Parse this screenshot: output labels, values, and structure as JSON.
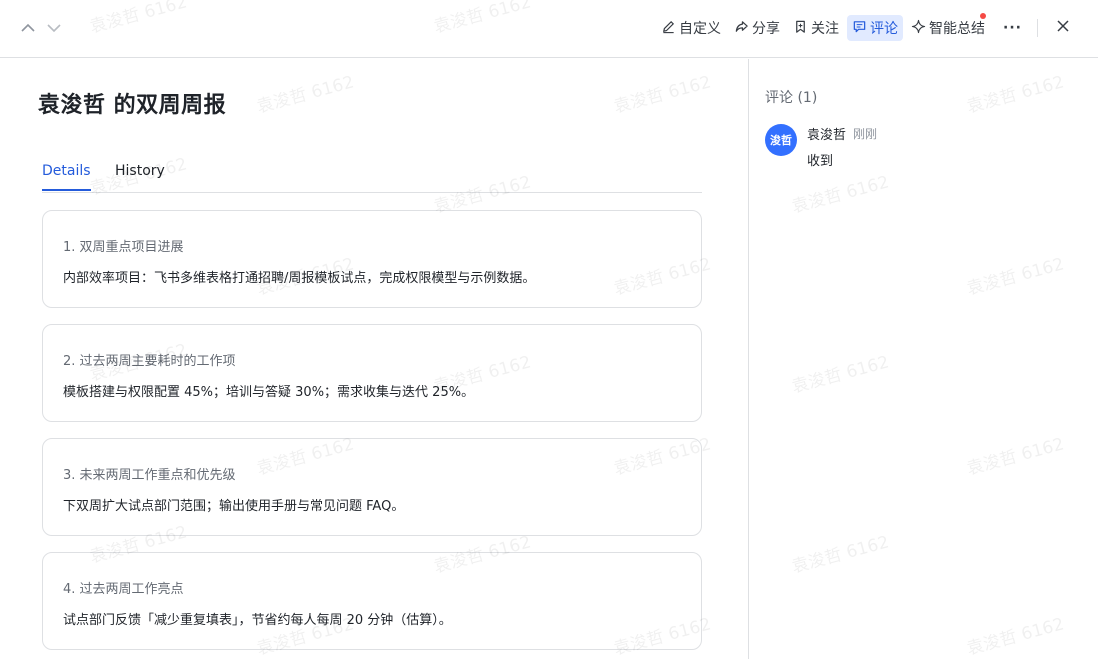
{
  "toolbar": {
    "actions": [
      {
        "label": "自定义",
        "icon": "pencil-icon"
      },
      {
        "label": "分享",
        "icon": "share-icon"
      },
      {
        "label": "关注",
        "icon": "bookmark-icon"
      },
      {
        "label": "评论",
        "icon": "comment-icon",
        "active": true
      },
      {
        "label": "智能总结",
        "icon": "sparkle-icon",
        "has_dot": true
      }
    ],
    "more": "···",
    "accent_color": "#245bdb",
    "dot_color": "#f54a45"
  },
  "doc": {
    "title": "袁浚哲 的双周周报",
    "tabs": [
      {
        "label": "Details",
        "active": true
      },
      {
        "label": "History",
        "active": false
      }
    ],
    "sections": [
      {
        "title": "1. 双周重点项目进展",
        "body": "内部效率项目：飞书多维表格打通招聘/周报模板试点，完成权限模型与示例数据。"
      },
      {
        "title": "2. 过去两周主要耗时的工作项",
        "body": "模板搭建与权限配置 45%；培训与答疑 30%；需求收集与迭代 25%。"
      },
      {
        "title": "3. 未来两周工作重点和优先级",
        "body": "下双周扩大试点部门范围；输出使用手册与常见问题 FAQ。"
      },
      {
        "title": "4. 过去两周工作亮点",
        "body": "试点部门反馈「减少重复填表」，节省约每人每周 20 分钟（估算）。"
      }
    ]
  },
  "comments": {
    "header": "评论 (1)",
    "items": [
      {
        "avatar_text": "浚哲",
        "author": "袁浚哲",
        "time": "刚刚",
        "text": "收到",
        "avatar_color": "#3370ff"
      }
    ]
  },
  "watermark": "袁浚哲 6162"
}
